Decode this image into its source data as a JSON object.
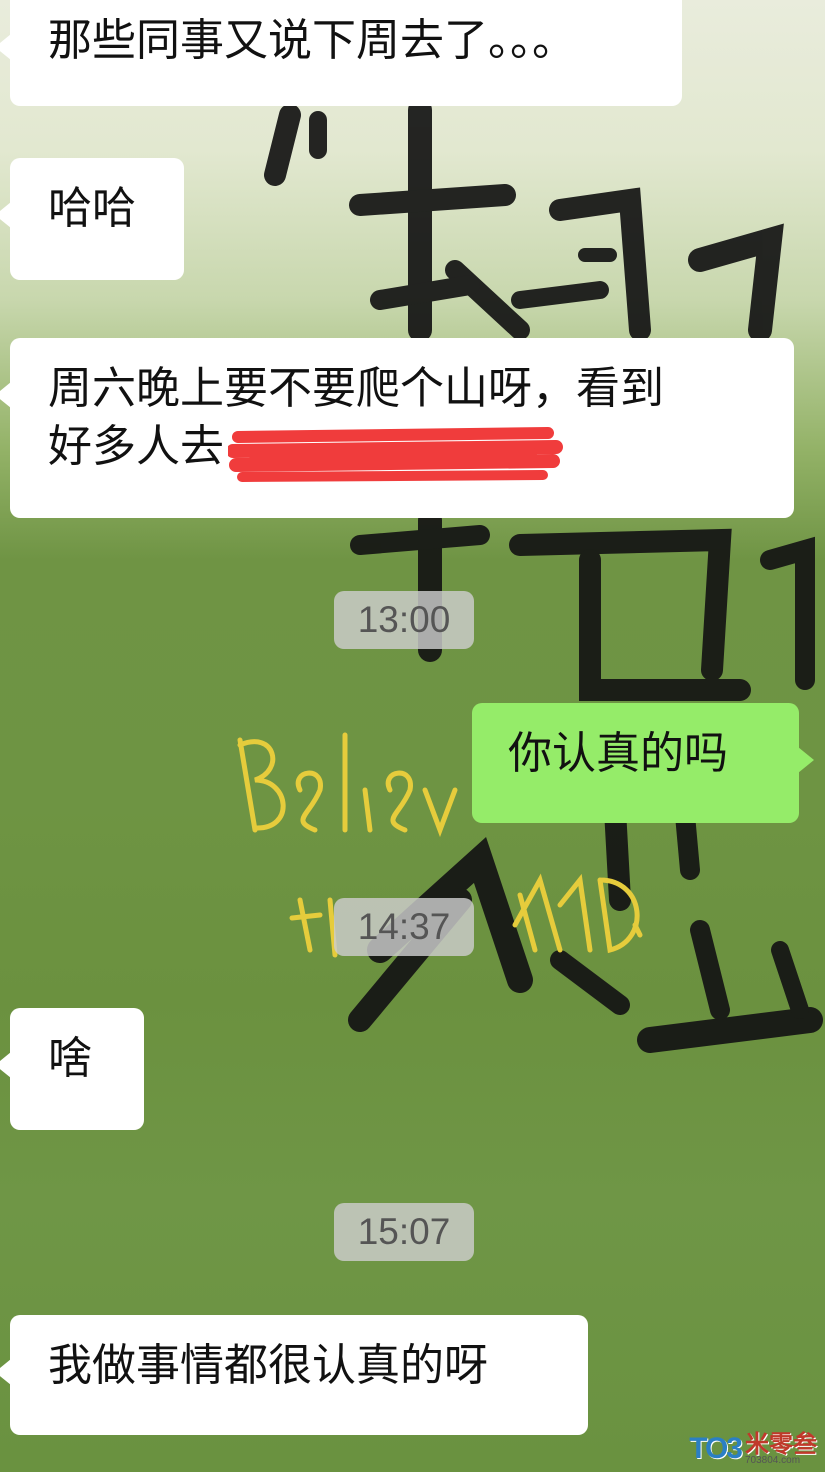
{
  "messages": [
    {
      "direction": "incoming",
      "text": "那些同事又说下周去了。。。"
    },
    {
      "direction": "incoming",
      "text": "哈哈"
    },
    {
      "direction": "incoming",
      "text": "周六晚上要不要爬个山呀，看到\n好多人去"
    },
    {
      "direction": "outgoing",
      "text": "你认真的吗"
    },
    {
      "direction": "incoming",
      "text": "啥"
    },
    {
      "direction": "incoming",
      "text": "我做事情都很认真的呀"
    }
  ],
  "timestamps": [
    "13:00",
    "14:37",
    "15:07"
  ],
  "wallpaper": {
    "caption": "Believe the LAND."
  },
  "watermark": {
    "logo": "TO3",
    "name": "米零叁",
    "url": "703804.com"
  },
  "colors": {
    "incoming_bubble": "#ffffff",
    "outgoing_bubble": "#95ec69",
    "redaction": "#f03c3c",
    "timestamp_bg": "#cdcdcd"
  }
}
